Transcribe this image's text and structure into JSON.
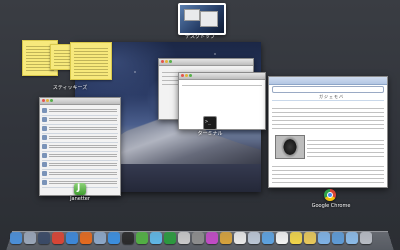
{
  "space": {
    "label": "デスクトップ"
  },
  "windows": {
    "stickies_label": "スティッキーズ",
    "terminal_label": "ターミナル",
    "janetter_label": "Janetter",
    "chrome_label": "Google Chrome",
    "chrome_blog_title": "ガジェモバ"
  },
  "dock": {
    "icons": [
      {
        "name": "finder-icon",
        "color": "#4b8fd8"
      },
      {
        "name": "launchpad-icon",
        "color": "#9aa6b8"
      },
      {
        "name": "dashboard-icon",
        "color": "#3a4a66"
      },
      {
        "name": "chrome-icon",
        "color": "#d94535"
      },
      {
        "name": "safari-icon",
        "color": "#3d88d9"
      },
      {
        "name": "firefox-icon",
        "color": "#e46a1e"
      },
      {
        "name": "mail-icon",
        "color": "#8ca7c8"
      },
      {
        "name": "app-store-icon",
        "color": "#3b8fe0"
      },
      {
        "name": "terminal-icon",
        "color": "#2a2a2a"
      },
      {
        "name": "janetter-icon",
        "color": "#52b043"
      },
      {
        "name": "messages-icon",
        "color": "#5fb7e5"
      },
      {
        "name": "facetime-icon",
        "color": "#2b9a3e"
      },
      {
        "name": "pen-icon",
        "color": "#c9c9c9"
      },
      {
        "name": "system-preferences-icon",
        "color": "#8d8d8d"
      },
      {
        "name": "itunes-icon",
        "color": "#c24bc6"
      },
      {
        "name": "photos-icon",
        "color": "#d6a23c"
      },
      {
        "name": "calendar-icon",
        "color": "#e9e9e9"
      },
      {
        "name": "cd-icon",
        "color": "#bcc7d6"
      },
      {
        "name": "preview-icon",
        "color": "#5da2e0"
      },
      {
        "name": "textedit-icon",
        "color": "#f3f3f3"
      },
      {
        "name": "stickies-icon",
        "color": "#f0d44a"
      },
      {
        "name": "notes-icon",
        "color": "#e8c85a"
      },
      {
        "name": "folder-icon",
        "color": "#7fb2e5"
      },
      {
        "name": "downloads-folder-icon",
        "color": "#5e9bd6"
      },
      {
        "name": "documents-folder-icon",
        "color": "#8cbbe8"
      },
      {
        "name": "trash-icon",
        "color": "#b8bcc4"
      }
    ]
  }
}
